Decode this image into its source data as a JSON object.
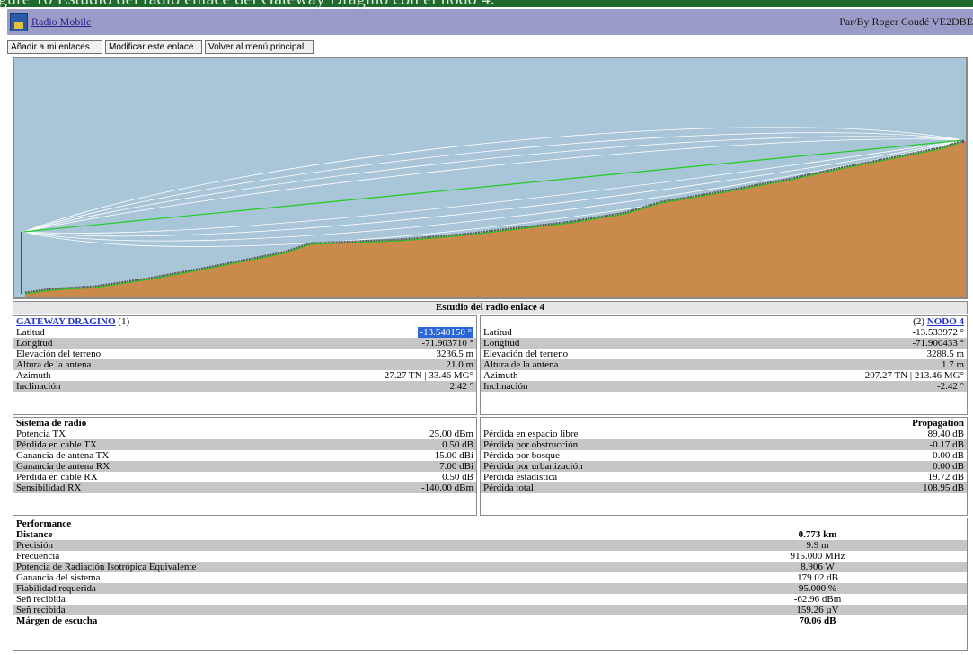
{
  "top_strip_text": "gure 10 Estudio del radio enlace del Gateway Dragino con el nodo 4.",
  "header": {
    "app_link": "Radio Mobile",
    "author": "Par/By Roger Coudé VE2DBE"
  },
  "toolbar": {
    "btn_add": "Añadir a mi enlaces",
    "btn_modify": "Modificar este enlace",
    "btn_back": "Volver al menú principal"
  },
  "study_title": "Estudio del radio enlace 4",
  "left_station": {
    "name": "GATEWAY DRAGINO",
    "num": "(1)",
    "rows": [
      {
        "label": "Latitud",
        "value": "-13.540150 °"
      },
      {
        "label": "Longitud",
        "value": "-71.903710 °"
      },
      {
        "label": "Elevación del terreno",
        "value": "3236.5 m"
      },
      {
        "label": "Altura de la antena",
        "value": "21.0 m"
      },
      {
        "label": "Azimuth",
        "value": "27.27 TN | 33.46 MG°"
      },
      {
        "label": "Inclinación",
        "value": "2.42 °"
      }
    ]
  },
  "right_station": {
    "name": "NODO 4",
    "num": "(2)",
    "rows": [
      {
        "label": "Latitud",
        "value": "-13.533972 °"
      },
      {
        "label": "Longitud",
        "value": "-71.900433 °"
      },
      {
        "label": "Elevación del terreno",
        "value": "3288.5 m"
      },
      {
        "label": "Altura de la antena",
        "value": "1.7 m"
      },
      {
        "label": "Azimuth",
        "value": "207.27 TN | 213.46 MG°"
      },
      {
        "label": "Inclinación",
        "value": "-2.42 °"
      }
    ]
  },
  "radio_system": {
    "title": "Sistema de radio",
    "rows": [
      {
        "label": "Potencia TX",
        "value": "25.00 dBm"
      },
      {
        "label": "Pérdida en cable TX",
        "value": "0.50 dB"
      },
      {
        "label": "Ganancia de antena TX",
        "value": "15.00 dBi"
      },
      {
        "label": "Ganancia de antena RX",
        "value": "7.00 dBi"
      },
      {
        "label": "Pérdida en cable RX",
        "value": "0.50 dB"
      },
      {
        "label": "Sensibilidad RX",
        "value": "-140.00 dBm"
      }
    ]
  },
  "propagation": {
    "title": "Propagation",
    "rows": [
      {
        "label": "Pérdida en espacio libre",
        "value": "89.40 dB"
      },
      {
        "label": "Pérdida por obstrucción",
        "value": "-0.17 dB"
      },
      {
        "label": "Pérdida por bosque",
        "value": "0.00 dB"
      },
      {
        "label": "Pérdida por urbanización",
        "value": "0.00 dB"
      },
      {
        "label": "Pérdida estadística",
        "value": "19.72 dB"
      },
      {
        "label": "Pérdida total",
        "value": "108.95 dB"
      }
    ]
  },
  "performance": {
    "title": "Performance",
    "rows": [
      {
        "label": "Distance",
        "value": "0.773 km",
        "bold": true
      },
      {
        "label": "Precisión",
        "value": "9.9 m"
      },
      {
        "label": "Frecuencia",
        "value": "915.000 MHz"
      },
      {
        "label": "Potencia de Radiación Isotrópica Equivalente",
        "value": "8.906 W"
      },
      {
        "label": "Ganancia del sistema",
        "value": "179.02 dB"
      },
      {
        "label": "Fiabilidad requerida",
        "value": "95.000 %"
      },
      {
        "label": "Señ recibida",
        "value": "-62.96 dBm"
      },
      {
        "label": "Señ recibida",
        "value": "159.26 µV"
      },
      {
        "label": "Márgen de escucha",
        "value": "70.06 dB",
        "bold": true
      }
    ]
  },
  "colors": {
    "sky": "#a8c6d8",
    "terrain": "#c98a4c",
    "los_line": "#22cc22",
    "fresnel": "#ffffff",
    "header_bg": "#9b9bc7",
    "row_alt": "#c6c6c6"
  }
}
